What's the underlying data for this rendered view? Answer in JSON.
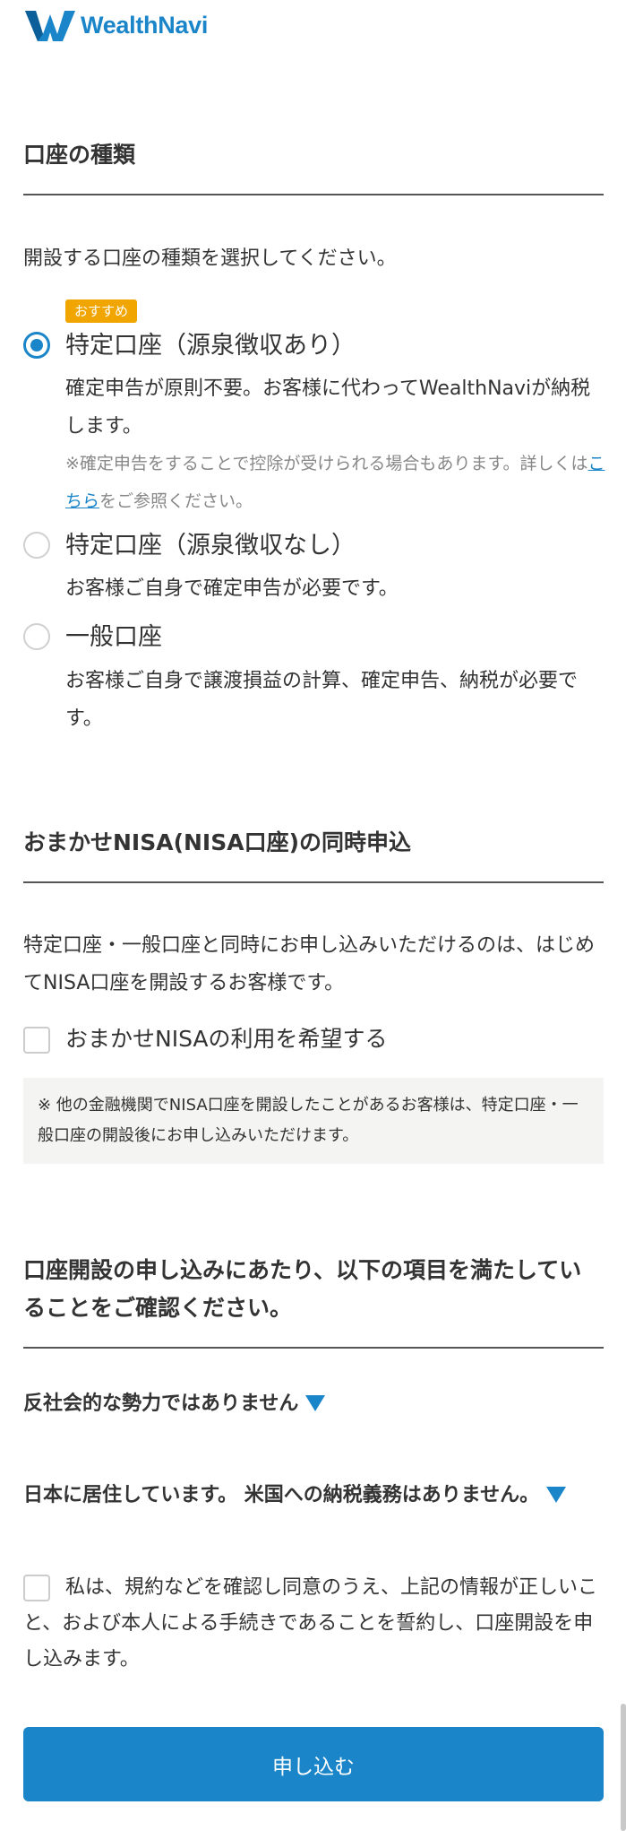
{
  "brand": {
    "name": "WealthNavi",
    "color": "#1a85c8"
  },
  "account_type": {
    "title": "口座の種類",
    "instruction": "開設する口座の種類を選択してください。",
    "recommend_badge": "おすすめ",
    "options": [
      {
        "label": "特定口座（源泉徴収あり）",
        "description": "確定申告が原則不要。お客様に代わってWealthNaviが納税します。",
        "note_prefix": "※確定申告をすることで控除が受けられる場合もあります。詳しくは",
        "note_link": "こちら",
        "note_suffix": "をご参照ください。",
        "selected": true
      },
      {
        "label": "特定口座（源泉徴収なし）",
        "description": "お客様ご自身で確定申告が必要です。",
        "selected": false
      },
      {
        "label": "一般口座",
        "description": "お客様ご自身で譲渡損益の計算、確定申告、納税が必要です。",
        "selected": false
      }
    ]
  },
  "nisa": {
    "title": "おまかせNISA(NISA口座)の同時申込",
    "description": "特定口座・一般口座と同時にお申し込みいただけるのは、はじめてNISA口座を開設するお客様です。",
    "checkbox_label": "おまかせNISAの利用を希望する",
    "note": "※ 他の金融機関でNISA口座を開設したことがあるお客様は、特定口座・一般口座の開設後にお申し込みいただけます。"
  },
  "confirm": {
    "title": "口座開設の申し込みにあたり、以下の項目を満たしていることをご確認ください。",
    "items": [
      "反社会的な勢力ではありません",
      "日本に居住しています。 米国への納税義務はありません。"
    ],
    "agreement": "私は、規約などを確認し同意のうえ、上記の情報が正しいこと、および本人による手続きであることを誓約し、口座開設を申し込みます。",
    "submit_label": "申し込む"
  }
}
